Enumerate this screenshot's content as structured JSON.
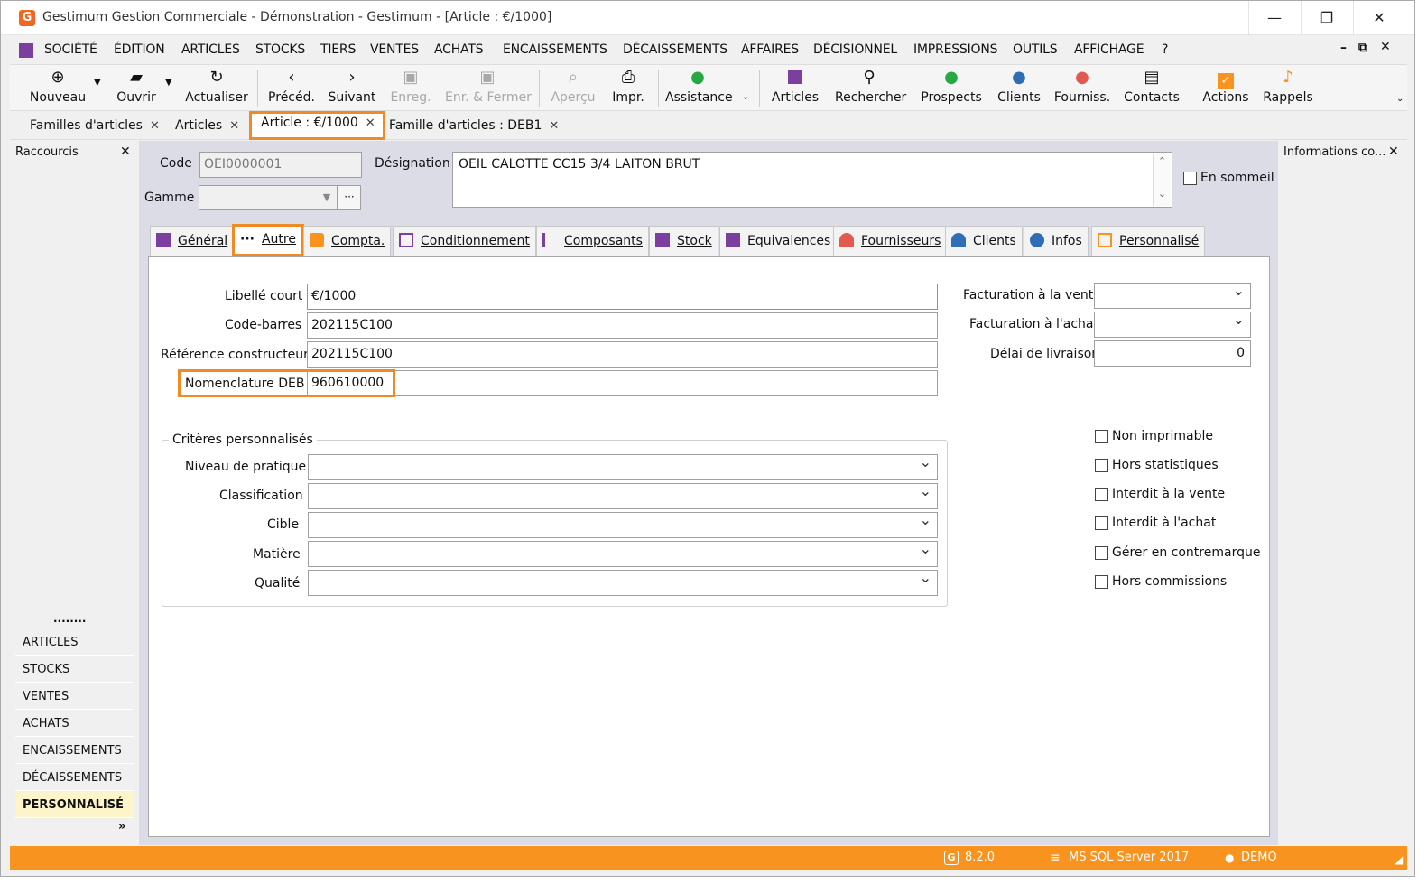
{
  "window": {
    "title": "Gestimum Gestion Commerciale - Démonstration - Gestimum - [Article : €/1000]",
    "logo_letter": "G",
    "minimize": "—",
    "maximize": "❐",
    "close": "✕"
  },
  "menu": [
    "SOCIÉTÉ",
    "ÉDITION",
    "ARTICLES",
    "STOCKS",
    "TIERS",
    "VENTES",
    "ACHATS",
    "ENCAISSEMENTS",
    "DÉCAISSEMENTS",
    "AFFAIRES",
    "DÉCISIONNEL",
    "IMPRESSIONS",
    "OUTILS",
    "AFFICHAGE",
    "?"
  ],
  "toolbar": {
    "nouveau": "Nouveau",
    "ouvrir": "Ouvrir",
    "actualiser": "Actualiser",
    "preced": "Précéd.",
    "suivant": "Suivant",
    "enreg": "Enreg.",
    "enr_fermer": "Enr. & Fermer",
    "apercu": "Aperçu",
    "impr": "Impr.",
    "assistance": "Assistance",
    "articles": "Articles",
    "rechercher": "Rechercher",
    "prospects": "Prospects",
    "clients": "Clients",
    "fourniss": "Fourniss.",
    "contacts": "Contacts",
    "actions": "Actions",
    "rappels": "Rappels"
  },
  "doc_tabs": [
    "Familles d'articles",
    "Articles",
    "Article : €/1000",
    "Famille d'articles : DEB1"
  ],
  "left_panel": {
    "title": "Raccourcis",
    "dots": "........",
    "items": [
      "ARTICLES",
      "STOCKS",
      "VENTES",
      "ACHATS",
      "ENCAISSEMENTS",
      "DÉCAISSEMENTS",
      "PERSONNALISÉ"
    ],
    "more": "»"
  },
  "right_panel": {
    "title": "Informations co..."
  },
  "header": {
    "code_label": "Code",
    "code_value": "OEI0000001",
    "designation_label": "Désignation",
    "designation_value": "OEIL CALOTTE CC15 3/4 LAITON BRUT",
    "gamme_label": "Gamme",
    "gamme_value": "",
    "sommeil_label": "En sommeil"
  },
  "form_tabs": [
    "Général",
    "Autre",
    "Compta.",
    "Conditionnement",
    "Composants",
    "Stock",
    "Equivalences",
    "Fournisseurs",
    "Clients",
    "Infos",
    "Personnalisé"
  ],
  "autre": {
    "libelle_court_label": "Libellé court",
    "libelle_court": "€/1000",
    "code_barres_label": "Code-barres",
    "code_barres": "202115C100",
    "ref_constructeur_label": "Référence constructeur",
    "ref_constructeur": "202115C100",
    "nomenclature_label": "Nomenclature DEB",
    "nomenclature": "960610000",
    "fact_vente_label": "Facturation à la vente",
    "fact_vente": "",
    "fact_achat_label": "Facturation à l'achat",
    "fact_achat": "",
    "delai_label": "Délai de livraison",
    "delai": "0",
    "criteres_title": "Critères personnalisés",
    "criteres": [
      {
        "label": "Niveau de pratique",
        "value": ""
      },
      {
        "label": "Classification",
        "value": ""
      },
      {
        "label": "Cible",
        "value": ""
      },
      {
        "label": "Matière",
        "value": ""
      },
      {
        "label": "Qualité",
        "value": ""
      }
    ],
    "checkboxes": [
      "Non imprimable",
      "Hors statistiques",
      "Interdit à la vente",
      "Interdit à l'achat",
      "Gérer en contremarque",
      "Hors commissions"
    ]
  },
  "status": {
    "version": "8.2.0",
    "server": "MS SQL Server 2017",
    "user": "DEMO"
  },
  "colors": {
    "accent": "#f08a24",
    "status_bar": "#f7931e",
    "purple": "#7b3fa0",
    "green": "#27a844",
    "blue": "#2f6db5",
    "red": "#e05a4f"
  }
}
